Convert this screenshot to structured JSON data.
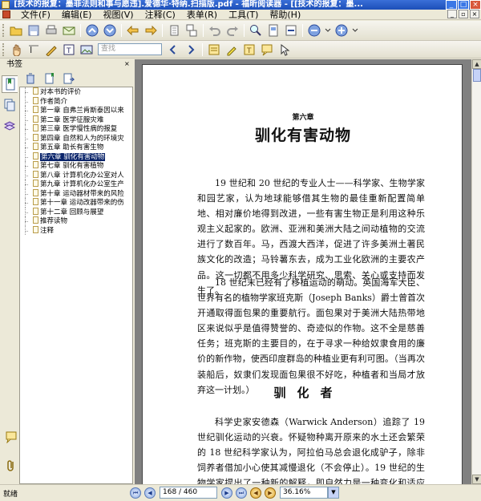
{
  "window": {
    "title": "[技术的报复：墨菲法则和事与愿违].爱德华·特纳.扫描版.pdf - 福昕阅读器 - [[技术的报复：墨..."
  },
  "menu": [
    "文件(F)",
    "编辑(E)",
    "视图(V)",
    "注释(C)",
    "表单(R)",
    "工具(T)",
    "帮助(H)"
  ],
  "toolbar": {
    "search_placeholder": "查找"
  },
  "panel": {
    "title": "书签",
    "bookmarks": [
      {
        "label": "对本书的评价",
        "selected": false
      },
      {
        "label": "作者简介",
        "selected": false
      },
      {
        "label": "第一章 自弗兰肯斯泰因以来",
        "selected": false
      },
      {
        "label": "第二章 医学征服灾难",
        "selected": false
      },
      {
        "label": "第三章 医学慢性病的报复",
        "selected": false
      },
      {
        "label": "第四章 自然和人为的环境灾",
        "selected": false
      },
      {
        "label": "第五章 助长有害生物",
        "selected": false
      },
      {
        "label": "第六章 驯化有害动物",
        "selected": true
      },
      {
        "label": "第七章 驯化有害植物",
        "selected": false
      },
      {
        "label": "第八章 计算机化办公室对人",
        "selected": false
      },
      {
        "label": "第九章 计算机化办公室生产",
        "selected": false
      },
      {
        "label": "第十章 运动器材带来的风险",
        "selected": false
      },
      {
        "label": "第十一章 运动改器带来的伤",
        "selected": false
      },
      {
        "label": "第十二章 回顾与展望",
        "selected": false
      },
      {
        "label": "推荐读物",
        "selected": false
      },
      {
        "label": "注释",
        "selected": false
      }
    ]
  },
  "document": {
    "chapter_number": "第六章",
    "chapter_title": "驯化有害动物",
    "paragraph1": "19 世纪和 20 世纪的专业人士——科学家、生物学家和园艺家，认为地球能够借其生物的最佳重新配置简单地、相对廉价地得到改进，一些有害生物正是利用这种乐观主义起家的。欧洲、亚洲和美洲大陆之间动植物的交流进行了数百年。马，西渡大西洋，促进了许多美洲土著民族文化的改造；马铃薯东去，成为工业化欧洲的主要农产品。这一切都不用多少科学研究、思索、关心或支持而发生了。",
    "paragraph2": "18 世纪末已经有了移植运动的萌动。英国海军大臣、世界有名的植物学家班克斯（Joseph Banks）爵士曾首次开通取得面包果的重要航行。面包果对于美洲大陆热带地区来说似乎是值得赞誉的、奇迹似的作物。这不全是慈善任务；班克斯的主要目的，在于寻求一种给奴隶食用的廉价的新作物，使西印度群岛的种植业更有利可图。（当再次装船后，奴隶们发现面包果很不好吃，种植者和当局才放弃这一计划。）",
    "section_heading": "驯化者",
    "paragraph3": "科学史家安德森（Warwick Anderson）追踪了 19 世纪驯化运动的兴衰。怀疑物种离开原来的水土还会繁荣的 18 世纪科学家认为，阿拉伯马总会退化成驴子，除非饲养者借加小心使其减慢退化（不会停止）。19 世纪的生物学家提出了一种新的解释，即自然力是一种变化和适应的作用，在这种作用"
  },
  "status": {
    "text": "就绪",
    "page_display": "168 / 460",
    "zoom": "36.16%"
  },
  "colors": {
    "title_bar": "#1c4fb8",
    "selection": "#0a246a",
    "workspace": "#808080"
  }
}
